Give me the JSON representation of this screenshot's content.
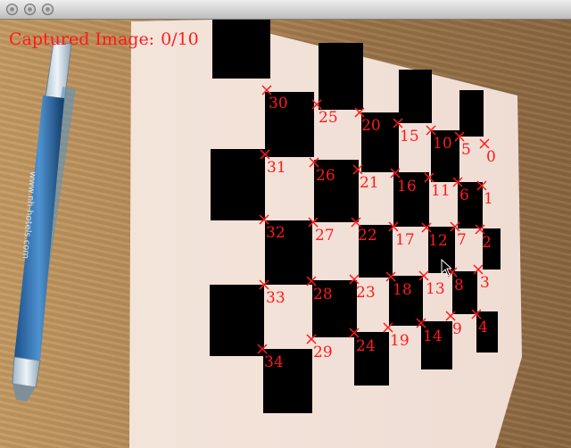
{
  "window": {
    "controls": [
      "close-button",
      "minimize-button",
      "zoom-button"
    ],
    "button_color": "#c4c4c4"
  },
  "overlay": {
    "caption_label": "Captured Image:",
    "caption_value": "0/10",
    "color": "#ff1a1a"
  },
  "scene": {
    "pen_text": "www.nh-hotels.com",
    "corner_labels": [
      "0",
      "1",
      "2",
      "3",
      "4",
      "5",
      "6",
      "7",
      "8",
      "9",
      "10",
      "11",
      "12",
      "13",
      "14",
      "15",
      "16",
      "17",
      "18",
      "19",
      "20",
      "21",
      "22",
      "23",
      "24",
      "25",
      "26",
      "27",
      "28",
      "29",
      "30",
      "31",
      "32",
      "33",
      "34"
    ]
  }
}
